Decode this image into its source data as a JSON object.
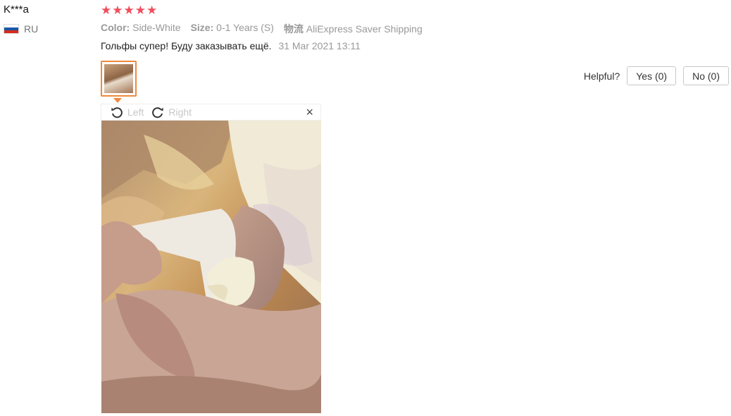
{
  "reviewer": {
    "name": "K***a",
    "country_code": "RU",
    "flag_colors": [
      "#ffffff",
      "#1c57a5",
      "#d52b1e"
    ]
  },
  "rating": {
    "stars": 5,
    "max": 5,
    "star_color": "#f04d5c"
  },
  "attributes": {
    "color_label": "Color:",
    "color_value": "Side-White",
    "size_label": "Size:",
    "size_value": "0-1 Years (S)",
    "shipping_label": "物流",
    "shipping_value": "AliExpress Saver Shipping"
  },
  "review": {
    "text": "Гольфы супер! Буду заказывать ещё.",
    "date": "31 Mar 2021 13:11"
  },
  "helpful": {
    "label": "Helpful?",
    "yes_label": "Yes (0)",
    "no_label": "No (0)"
  },
  "viewer": {
    "rotate_left_label": "Left",
    "rotate_right_label": "Right",
    "close_symbol": "×",
    "thumbnail_border_color": "#ef8a3c"
  }
}
